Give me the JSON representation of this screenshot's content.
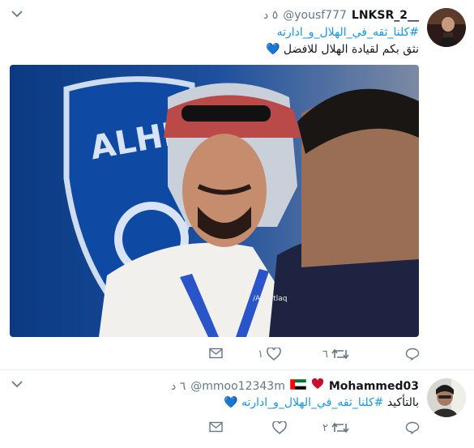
{
  "tweets": [
    {
      "name": "LNKSR_2__",
      "handle": "@yousf777",
      "time": "٥ د",
      "hashtag": "#كلنا_ثقه_في_الهلال_و_ادارته",
      "text": "نثق بكم لقيادة الهلال للافضل",
      "text_emoji": "💙",
      "photo_watermark": "/AlMutlaq",
      "photo_logo": "ALHILAL",
      "actions": {
        "reply_count": "",
        "retweet_count": "٦",
        "like_count": "١"
      }
    },
    {
      "name": "Mohammed03",
      "handle": "@mmoo12343m",
      "time": "٦ د",
      "text_prefix": "بالتأكيد",
      "hashtag": "#كلنا_ثقه_في_الهلال_و_ادارته",
      "text_emoji": "💙",
      "actions": {
        "reply_count": "",
        "retweet_count": "٢",
        "like_count": ""
      }
    }
  ],
  "colors": {
    "link": "#1b95e0",
    "muted": "#657786",
    "name_heart": "#e0245e",
    "divider": "#e6ecf0"
  },
  "icons": [
    "caret-down-icon",
    "reply-icon",
    "retweet-icon",
    "like-icon",
    "message-icon",
    "uae-flag-icon",
    "red-heart-icon"
  ]
}
